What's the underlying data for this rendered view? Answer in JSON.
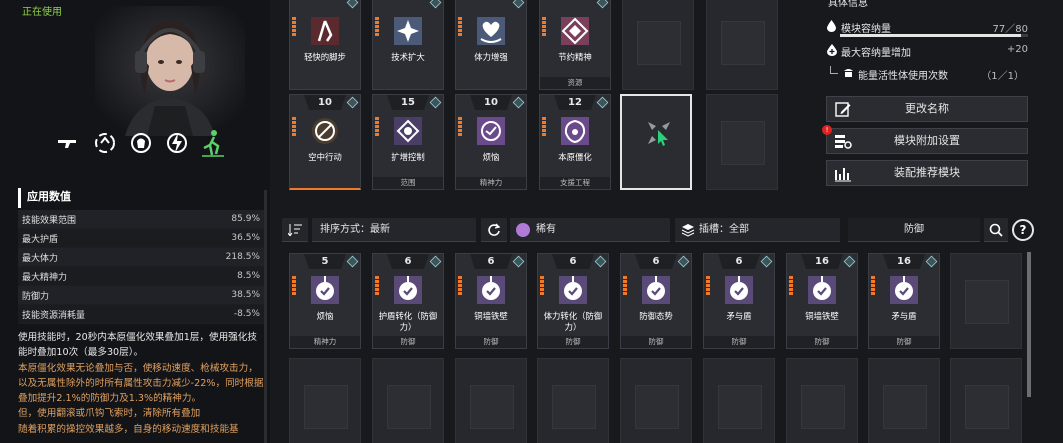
{
  "status": "正在使用",
  "skills": [
    "gun-icon",
    "spin-icon",
    "shield-head-icon",
    "lightning-icon",
    "runner-icon"
  ],
  "stats_title": "应用数值",
  "stats": [
    {
      "label": "技能效果范围",
      "value": "85.9%"
    },
    {
      "label": "最大护盾",
      "value": "36.5%"
    },
    {
      "label": "最大体力",
      "value": "218.5%"
    },
    {
      "label": "最大精神力",
      "value": "8.5%"
    },
    {
      "label": "防御力",
      "value": "38.5%"
    },
    {
      "label": "技能资源消耗量",
      "value": "-8.5%"
    }
  ],
  "description": {
    "line1": "使用技能时，20秒内本原僵化效果叠加1层，使用强化技能时叠加10次（最多30层）。",
    "line2": "本原僵化效果无论叠加与否，使移动速度、枪械攻击力，以及无属性除外的时所有属性攻击力减少-22%，同时根据叠加提升2.1%的防御力及1.3%的精神力。",
    "line3": "但，使用翻滚或爪钩飞索时，清除所有叠加",
    "line4": "随着积累的操控效果越多，自身的移动速度和技能基"
  },
  "equipped": [
    {
      "name": "轻快的脚步",
      "type": "",
      "level": ""
    },
    {
      "name": "技术扩大",
      "type": "",
      "level": ""
    },
    {
      "name": "体力增强",
      "type": "",
      "level": ""
    },
    {
      "name": "节约精神",
      "type": "资源",
      "level": ""
    },
    {
      "name": "空中行动",
      "type": "",
      "level": "10"
    },
    {
      "name": "扩增控制",
      "type": "范围",
      "level": "15"
    },
    {
      "name": "烦恼",
      "type": "精神力",
      "level": "10"
    },
    {
      "name": "本原僵化",
      "type": "支援工程",
      "level": "12"
    }
  ],
  "toolbar": {
    "sort_label": "排序方式：最新",
    "rarity_label": "稀有",
    "slot_label": "插槽：全部",
    "search_value": "防御",
    "help": "?"
  },
  "inventory": [
    {
      "name": "烦恼",
      "type": "精神力",
      "level": "5"
    },
    {
      "name": "护盾转化（防御力）",
      "type": "防御",
      "level": "6"
    },
    {
      "name": "铜墙铁壁",
      "type": "防御",
      "level": "6"
    },
    {
      "name": "体力转化（防御力）",
      "type": "防御",
      "level": "6"
    },
    {
      "name": "防御态势",
      "type": "防御",
      "level": "6"
    },
    {
      "name": "矛与盾",
      "type": "防御",
      "level": "6"
    },
    {
      "name": "铜墙铁壁",
      "type": "防御",
      "level": "16"
    },
    {
      "name": "矛与盾",
      "type": "防御",
      "level": "16"
    }
  ],
  "right": {
    "section_title": "具体信息",
    "capacity_label": "模块容纳量",
    "capacity_value": "77／80",
    "capacity_fraction": 0.9625,
    "max_capacity_label": "最大容纳量增加",
    "max_capacity_value": "+20",
    "activator_label": "能量活性体使用次数",
    "activator_value": "（1／1）",
    "rename_label": "更改名称",
    "extra_label": "模块附加设置",
    "recommend_label": "装配推荐模块"
  },
  "colors": {
    "accent": "#f07a2a",
    "purple": "#b07ad8",
    "green": "#8fd34a",
    "teal": "#9fd2d8"
  }
}
